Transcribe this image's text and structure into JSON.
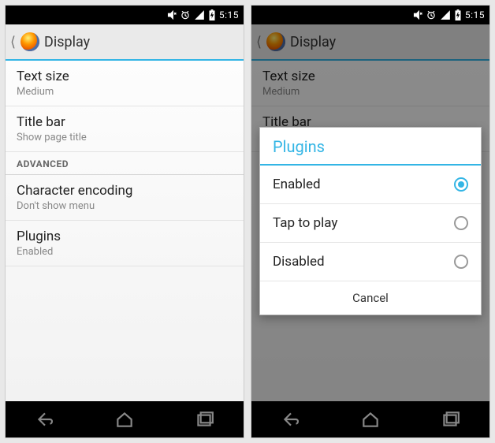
{
  "status": {
    "time": "5:15"
  },
  "header": {
    "title": "Display"
  },
  "rows": {
    "text_size": {
      "title": "Text size",
      "sub": "Medium"
    },
    "title_bar": {
      "title": "Title bar",
      "sub": "Show page title"
    },
    "advanced_label": "ADVANCED",
    "char_enc": {
      "title": "Character encoding",
      "sub": "Don't show menu"
    },
    "plugins": {
      "title": "Plugins",
      "sub": "Enabled"
    }
  },
  "dialog": {
    "title": "Plugins",
    "options": {
      "enabled": "Enabled",
      "tap": "Tap to play",
      "disabled": "Disabled"
    },
    "cancel": "Cancel",
    "selected": "enabled"
  }
}
